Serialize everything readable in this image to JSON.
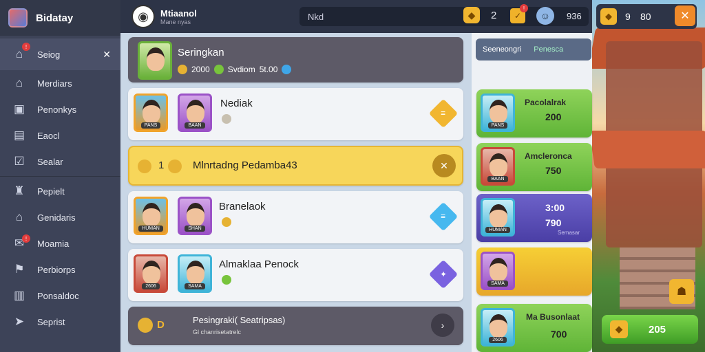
{
  "sidebar": {
    "title": "Bidatay",
    "items": [
      {
        "label": "Seiog",
        "icon": "home-icon",
        "badge": "!"
      },
      {
        "label": "Merdiars",
        "icon": "house-icon"
      },
      {
        "label": "Penonkys",
        "icon": "shield-icon"
      },
      {
        "label": "Eaocl",
        "icon": "gear-icon"
      },
      {
        "label": "Sealar",
        "icon": "check-icon"
      },
      {
        "label": "Pepielt",
        "icon": "trophy-icon"
      },
      {
        "label": "Genidaris",
        "icon": "castle-icon"
      },
      {
        "label": "Moamia",
        "icon": "chat-icon",
        "badge": "!"
      },
      {
        "label": "Perbiorps",
        "icon": "flag-icon"
      },
      {
        "label": "Ponsaldoc",
        "icon": "gift-icon"
      },
      {
        "label": "Seprist",
        "icon": "arrow-icon"
      }
    ]
  },
  "topbar": {
    "username": "Mtiaanol",
    "subtitle": "Mane nyas",
    "search": "Nkd",
    "count1": "2",
    "gift_badge": "!",
    "count2": "936"
  },
  "currency": {
    "a": "9",
    "b": "80"
  },
  "rows": [
    {
      "title": "Seringkan",
      "stats": [
        "2000",
        "Svdiom",
        "5t.00"
      ]
    },
    {
      "title": "Nediak",
      "labels": [
        "PANS",
        "BAAN"
      ]
    },
    {
      "title": "Mlnrtadng Pedamba43",
      "prefix": "1"
    },
    {
      "title": "Branelaok",
      "labels": [
        "HUMAN",
        "SHAN"
      ]
    },
    {
      "title": "Almaklaa Penock",
      "labels": [
        "2606",
        "SAMA"
      ]
    },
    {
      "title": "Pesingraki( Seatripsas)",
      "sub": "Gl chanrisetatrelc",
      "prefix": "D"
    }
  ],
  "rightpanel": {
    "tabs": [
      "Seeneongri",
      "Penesca"
    ],
    "cards": [
      {
        "title": "Pacolalrak",
        "value": "200",
        "label": "PANS"
      },
      {
        "title": "Amcleronca",
        "value": "750",
        "label": "BAAN"
      },
      {
        "title": "3:00",
        "value": "790",
        "sub": "Semasar",
        "label": "HUMAN"
      },
      {
        "title": "",
        "value": "",
        "label": "SAMA"
      },
      {
        "title": "Ma Busonlaat",
        "value": "700",
        "label": "2606"
      }
    ]
  },
  "bottom": {
    "buy_value": "205"
  },
  "colors": {
    "sidebar": "#3d4358",
    "accent": "#f1b630",
    "green": "#5fb437"
  }
}
